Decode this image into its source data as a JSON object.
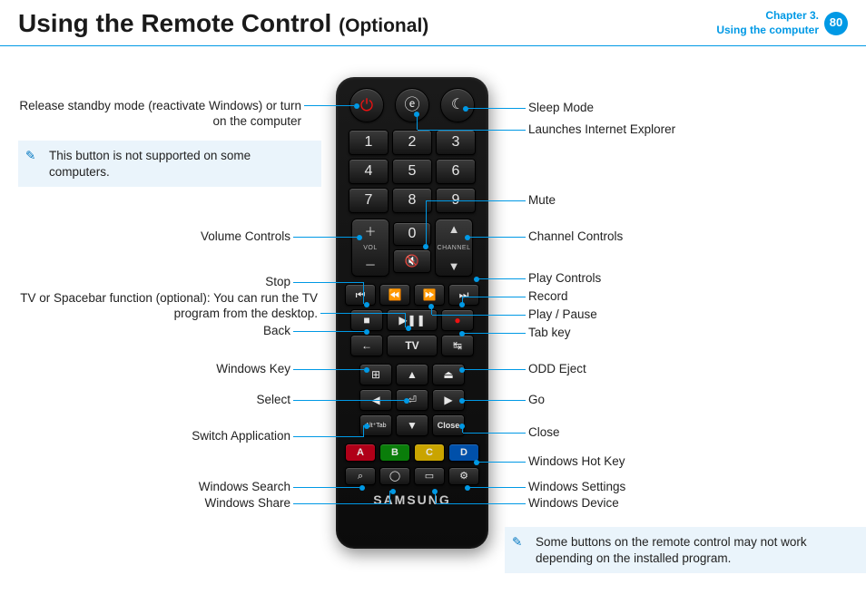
{
  "header": {
    "title_main": "Using the Remote Control",
    "title_suffix": "(Optional)",
    "chapter_line1": "Chapter 3.",
    "chapter_line2": "Using the computer",
    "page_number": "80"
  },
  "remote": {
    "numbers": [
      "1",
      "2",
      "3",
      "4",
      "5",
      "6",
      "7",
      "8",
      "9",
      "0"
    ],
    "vol_label": "VOL",
    "ch_label": "CHANNEL",
    "tv_label": "TV",
    "alt_tab_label": "Alt⁺Tab",
    "close_label": "Close",
    "color_keys": [
      "A",
      "B",
      "C",
      "D"
    ],
    "brand": "SAMSUNG"
  },
  "left_labels": {
    "power": "Release standby mode (reactivate Windows) or turn on the computer",
    "volume": "Volume Controls",
    "stop": "Stop",
    "tv_space": "TV or Spacebar function (optional): You can run the TV program from the desktop.",
    "back": "Back",
    "win_key": "Windows Key",
    "select": "Select",
    "switch_app": "Switch Application",
    "win_search": "Windows Search",
    "win_share": "Windows Share"
  },
  "right_labels": {
    "sleep": "Sleep Mode",
    "ie": "Launches Internet Explorer",
    "mute": "Mute",
    "channel": "Channel Controls",
    "play_controls": "Play Controls",
    "record": "Record",
    "play_pause": "Play / Pause",
    "tab_key": "Tab key",
    "odd_eject": "ODD Eject",
    "go": "Go",
    "close": "Close",
    "hot_key": "Windows Hot Key",
    "settings": "Windows Settings",
    "device": "Windows Device"
  },
  "notes": {
    "top": "This button is not supported on some computers.",
    "bottom": "Some buttons on the remote control may not work depending on the installed program."
  }
}
